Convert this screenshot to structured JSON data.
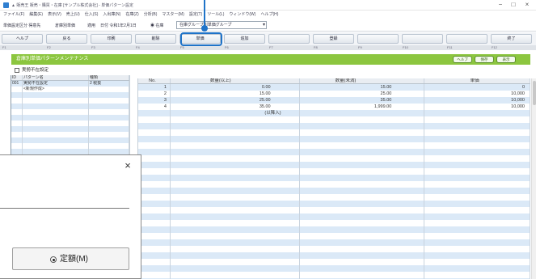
{
  "window": {
    "title": "▲ 販売王 販売・購買・在庫 [サンプル株式会社] - 単価パターン設定",
    "minimize": "−",
    "maximize": "□",
    "close": "×"
  },
  "menu": [
    "ファイル(F)",
    "編集(E)",
    "表示(V)",
    "売上(U)",
    "仕入(S)",
    "入出庫(N)",
    "在庫(Z)",
    "分析(B)",
    "マスター(M)",
    "設定(T)",
    "ツール(L)",
    "ウィンドウ(W)",
    "ヘルプ(H)"
  ],
  "toolbar": {
    "items": [
      "単価設定区分 得意先",
      "倉庫別単価",
      "適用",
      "日付 令和1年2月1日",
      "◉ 在庫"
    ],
    "dropdown_value": "在庫グループ別単価グループ",
    "dropdown_arrow": "▾"
  },
  "fkeys": [
    {
      "key": "F1",
      "label": "ヘルプ"
    },
    {
      "key": "F2",
      "label": "戻る"
    },
    {
      "key": "F3",
      "label": "印刷"
    },
    {
      "key": "F4",
      "label": "削除"
    },
    {
      "key": "F5",
      "label": "単価"
    },
    {
      "key": "F6",
      "label": "追加"
    },
    {
      "key": "F7",
      "label": ""
    },
    {
      "key": "F8",
      "label": "登録"
    },
    {
      "key": "F9",
      "label": ""
    },
    {
      "key": "F10",
      "label": ""
    },
    {
      "key": "F11",
      "label": ""
    },
    {
      "key": "F12",
      "label": "終了"
    }
  ],
  "colors": {
    "callout": "#1f73c8",
    "title_bar": "#8cc63f",
    "row_stripe": "#dbe9f7",
    "header": "#e9edf2"
  },
  "panel": {
    "title": "倉庫別単価パターンメンテナンス",
    "buttons": [
      "ヘルプ",
      "保存",
      "表示"
    ],
    "checkbox_label": "実勢不在設定",
    "checkbox_checked": false
  },
  "pattern_table": {
    "headers": [
      "ID",
      "パターン名",
      "種類"
    ],
    "rows": [
      {
        "id": "001",
        "name": "実勢不在設定",
        "type": "2 税抜"
      },
      {
        "id": "",
        "name": "<新規作成>",
        "type": ""
      }
    ]
  },
  "price_table": {
    "headers": [
      "No.",
      "数量(以上)",
      "数量(未満)",
      "単価"
    ],
    "rows": [
      {
        "no": "1",
        "from": "0.00",
        "to": "15.00",
        "price": "0"
      },
      {
        "no": "2",
        "from": "15.00",
        "to": "25.00",
        "price": "10,000"
      },
      {
        "no": "3",
        "from": "25.00",
        "to": "35.00",
        "price": "10,000"
      },
      {
        "no": "4",
        "from": "35.00",
        "to": "1,999.00",
        "price": "10,000"
      }
    ],
    "next_row_hint": "(以降入)"
  },
  "dialog": {
    "close": "×",
    "radio_label": "定額(M)",
    "radio_selected": true
  }
}
